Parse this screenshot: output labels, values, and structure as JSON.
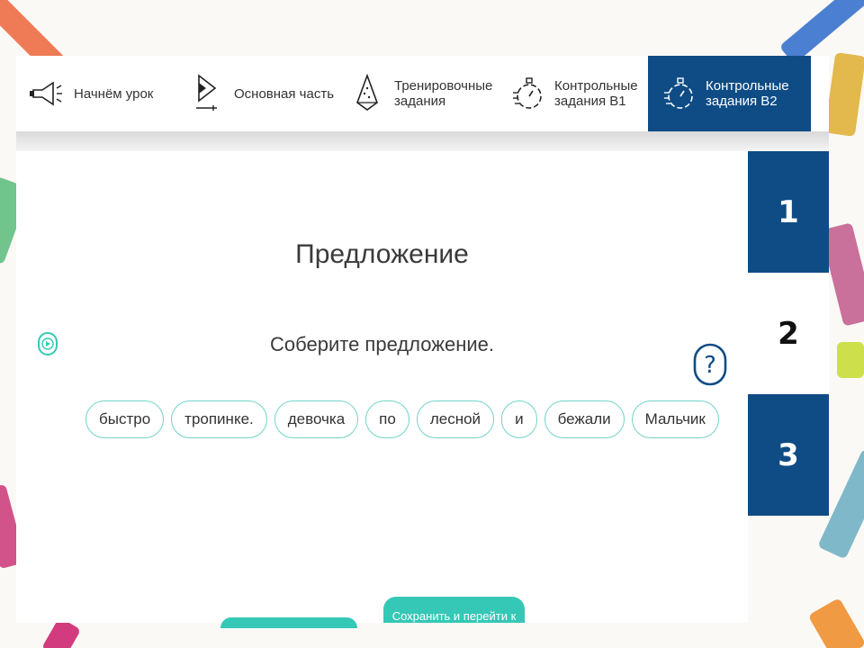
{
  "nav": {
    "items": [
      {
        "label": "Начнём урок",
        "icon": "megaphone-icon"
      },
      {
        "label": "Основная часть",
        "icon": "play-icon"
      },
      {
        "label": "Тренировочные\nзадания",
        "icon": "cone-icon"
      },
      {
        "label": "Контрольные\nзадания В1",
        "icon": "stopwatch-icon"
      },
      {
        "label": "Контрольные\nзадания В2",
        "icon": "stopwatch-icon",
        "active": true
      }
    ],
    "active_color": "#0f4c85"
  },
  "lesson": {
    "title": "Предложение",
    "instruction": "Соберите предложение.",
    "help_label": "?"
  },
  "words": [
    "быстро",
    "тропинке.",
    "девочка",
    "по",
    "лесной",
    "и",
    "бежали",
    "Мальчик"
  ],
  "tabs": [
    "1",
    "2",
    "3"
  ],
  "buttons": {
    "save_label": "Сохранить и перейти к"
  },
  "colors": {
    "accent": "#35c8b6",
    "word_border": "#73d3c6",
    "tab_blue": "#0f4c85"
  }
}
